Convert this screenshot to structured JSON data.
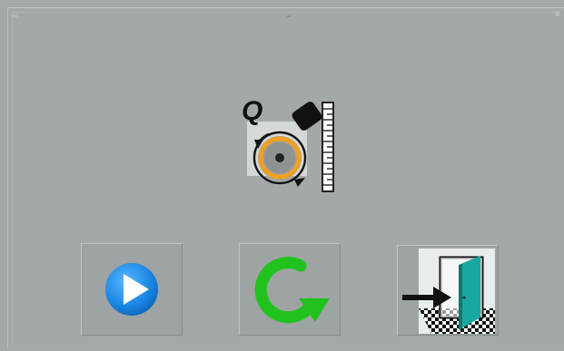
{
  "window": {
    "background": "#a4a9a9"
  },
  "logo": {
    "letter": "Q",
    "icon": "q-saw-logo-icon",
    "ring_color": "#f0a020"
  },
  "toolbar": {
    "buttons": [
      {
        "icon": "play-icon",
        "action": "start",
        "color": "#1e88e5"
      },
      {
        "icon": "refresh-icon",
        "action": "repeat",
        "color": "#22c21e"
      },
      {
        "icon": "exit-door-icon",
        "action": "exit",
        "color": "#1aa6a0"
      }
    ]
  }
}
